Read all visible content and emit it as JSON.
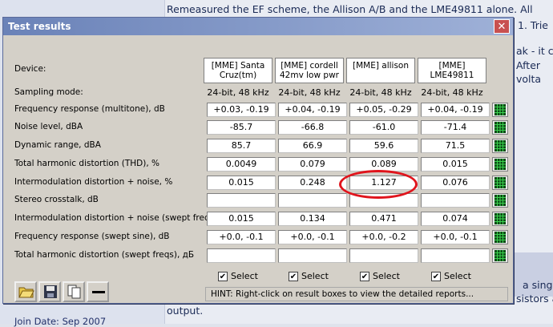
{
  "background": {
    "lines": [
      "Remeasured the EF scheme, the Allison A/B and the LME49811 alone. All",
      "1. Trie",
      "ak - it c",
      "After",
      "volta",
      "a sing",
      "sistors a",
      "output."
    ],
    "join_date": "Join Date: Sep 2007"
  },
  "window": {
    "title": "Test results",
    "close_label": "✕"
  },
  "labels": {
    "device": "Device:",
    "sampling": "Sampling mode:"
  },
  "devices": [
    "[MME] Santa Cruz(tm)",
    "[MME] cordell 42mv low pwr",
    "[MME] allison",
    "[MME] LME49811"
  ],
  "sampling": [
    "24-bit, 48 kHz",
    "24-bit, 48 kHz",
    "24-bit, 48 kHz",
    "24-bit, 48 kHz"
  ],
  "rows": [
    {
      "label": "Frequency response (multitone), dB",
      "values": [
        "+0.03, -0.19",
        "+0.04, -0.19",
        "+0.05, -0.29",
        "+0.04, -0.19"
      ]
    },
    {
      "label": "Noise level, dBA",
      "values": [
        "-85.7",
        "-66.8",
        "-61.0",
        "-71.4"
      ]
    },
    {
      "label": "Dynamic range, dBA",
      "values": [
        "85.7",
        "66.9",
        "59.6",
        "71.5"
      ]
    },
    {
      "label": "Total harmonic distortion (THD), %",
      "values": [
        "0.0049",
        "0.079",
        "0.089",
        "0.015"
      ]
    },
    {
      "label": "Intermodulation distortion + noise, %",
      "values": [
        "0.015",
        "0.248",
        "1.127",
        "0.076"
      ]
    },
    {
      "label": "Stereo crosstalk, dB",
      "values": [
        "",
        "",
        "",
        ""
      ]
    },
    {
      "label": "Intermodulation distortion + noise (swept freqs), %",
      "values": [
        "0.015",
        "0.134",
        "0.471",
        "0.074"
      ]
    },
    {
      "label": "Frequency response (swept sine), dB",
      "values": [
        "+0.0, -0.1",
        "+0.0, -0.1",
        "+0.0, -0.2",
        "+0.0, -0.1"
      ]
    },
    {
      "label": "Total harmonic distortion (swept freqs), дБ",
      "values": [
        "",
        "",
        "",
        ""
      ]
    }
  ],
  "select_label": "Select",
  "check_mark": "✔",
  "hint": "HINT: Right-click on result boxes to view the detailed reports...",
  "colors": {
    "title_bar": "#7a90c4",
    "close_button": "#c85050",
    "highlight_ring": "#e0141c"
  }
}
